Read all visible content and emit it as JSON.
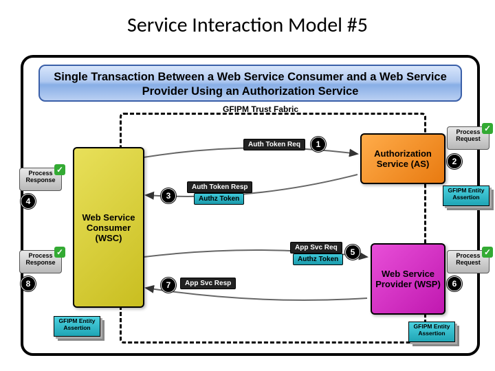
{
  "title": "Service Interaction Model #5",
  "banner": "Single Transaction Between a Web Service Consumer and a Web Service Provider Using an Authorization Service",
  "trust_label": "GFIPM Trust Fabric",
  "actors": {
    "wsc": "Web Service Consumer (WSC)",
    "as": "Authorization Service (AS)",
    "wsp": "Web Service Provider (WSP)"
  },
  "steps": {
    "1": "Auth Token Req",
    "2": "Process Request",
    "3_a": "Auth Token Resp",
    "3_b": "Authz Token",
    "4": "Process Response",
    "5_a": "App Svc Req",
    "5_b": "Authz Token",
    "6": "Process Request",
    "7": "App Svc Resp",
    "8": "Process Response"
  },
  "assertion_label": "GFIPM Entity Assertion"
}
